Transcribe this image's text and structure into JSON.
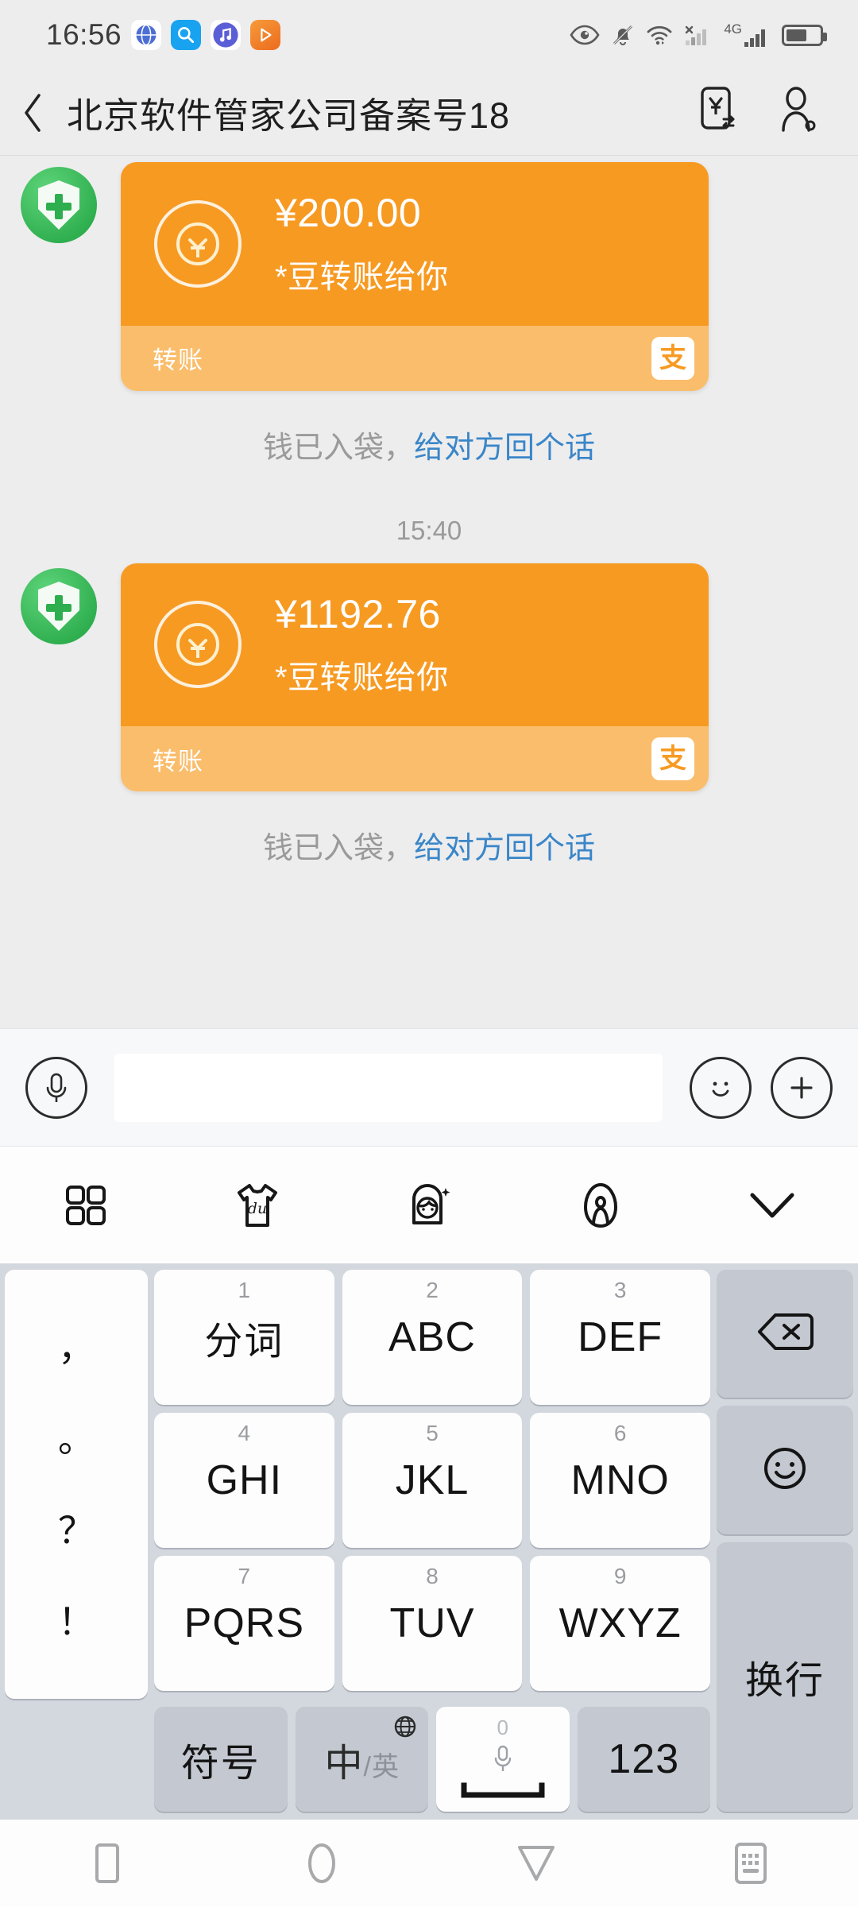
{
  "statusbar": {
    "time": "16:56",
    "app_icons": [
      "globe-icon",
      "search-icon",
      "music-icon",
      "video-icon"
    ],
    "right_icons": [
      "eye-icon",
      "bell-muted-icon",
      "wifi-icon",
      "signal-no-service-icon",
      "signal-4g-icon",
      "battery-icon"
    ],
    "network_label": "4G"
  },
  "titlebar": {
    "back": "‹",
    "title": "北京软件管家公司备案号18",
    "actions": [
      "transfer-money-icon",
      "contact-profile-icon"
    ]
  },
  "chat": {
    "messages": [
      {
        "type": "transfer",
        "avatar": "green-shield-plus-avatar",
        "amount": "¥200.00",
        "note": "*豆转账给你",
        "footer_label": "转账",
        "brand_badge": "支",
        "status_prefix": "钱已入袋，",
        "status_link": "给对方回个话"
      },
      {
        "type": "timestamp",
        "time": "15:40"
      },
      {
        "type": "transfer",
        "avatar": "green-shield-plus-avatar",
        "amount": "¥1192.76",
        "note": "*豆转账给你",
        "footer_label": "转账",
        "brand_badge": "支",
        "status_prefix": "钱已入袋，",
        "status_link": "给对方回个话"
      }
    ]
  },
  "inputbar": {
    "voice_icon": "microphone-icon",
    "field_value": "",
    "field_placeholder": "",
    "emoji_icon": "smiley-icon",
    "more_icon": "plus-icon"
  },
  "kb_toolbar": {
    "items": [
      "grid-apps-icon",
      "du-skin-shirt-icon",
      "sticker-avatar-icon",
      "baidu-paw-icon",
      "collapse-keyboard-chevron-icon"
    ]
  },
  "keyboard": {
    "punct_key": {
      "marks": [
        "，",
        "。",
        "？",
        "！"
      ]
    },
    "rows": [
      [
        {
          "num": "1",
          "label": "分词",
          "cn": true
        },
        {
          "num": "2",
          "label": "ABC",
          "cn": false
        },
        {
          "num": "3",
          "label": "DEF",
          "cn": false
        }
      ],
      [
        {
          "num": "4",
          "label": "GHI",
          "cn": false
        },
        {
          "num": "5",
          "label": "JKL",
          "cn": false
        },
        {
          "num": "6",
          "label": "MNO",
          "cn": false
        }
      ],
      [
        {
          "num": "7",
          "label": "PQRS",
          "cn": false
        },
        {
          "num": "8",
          "label": "TUV",
          "cn": false
        },
        {
          "num": "9",
          "label": "WXYZ",
          "cn": false
        }
      ]
    ],
    "right_col": [
      {
        "name": "backspace-key",
        "icon": "backspace-icon"
      },
      {
        "name": "emoji-key",
        "icon": "smiley-icon"
      },
      {
        "name": "newline-key",
        "label": "换行"
      }
    ],
    "bottom_row": {
      "symbols_label": "符号",
      "lang_cn": "中",
      "lang_sep": "/",
      "lang_en": "英",
      "space_zero": "0",
      "space_icon": "microphone-icon",
      "numeric_label": "123"
    }
  },
  "navbar": {
    "items": [
      "recents-square-icon",
      "home-circle-icon",
      "back-triangle-icon",
      "keyboard-icon"
    ]
  }
}
